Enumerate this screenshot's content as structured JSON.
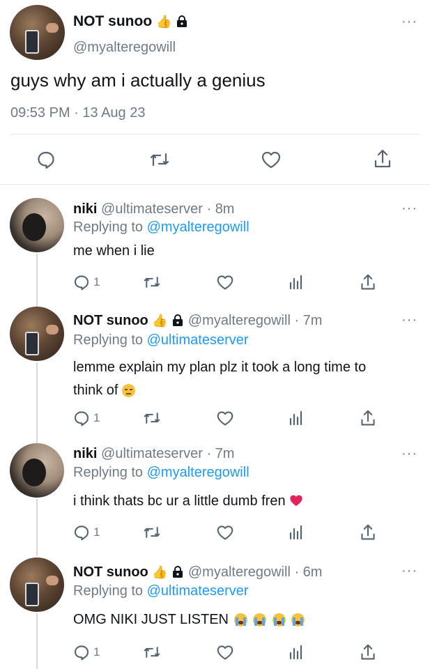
{
  "main_tweet": {
    "display_name": "NOT sunoo",
    "handle": "@myalteregowill",
    "text": "guys why am i actually a genius",
    "timestamp": "09:53 PM · 13 Aug 23"
  },
  "replies": [
    {
      "display_name": "niki",
      "meta": "@ultimateserver · 8m",
      "replying_label": "Replying to",
      "replying_to": "@myalteregowill",
      "text": "me when i lie",
      "reply_count": "1"
    },
    {
      "display_name": "NOT sunoo",
      "meta": "@myalteregowill · 7m",
      "replying_label": "Replying to",
      "replying_to": "@ultimateserver",
      "text_line1": "lemme explain my plan plz it took a long time to",
      "text_line2": "think of",
      "reply_count": "1"
    },
    {
      "display_name": "niki",
      "meta": "@ultimateserver · 7m",
      "replying_label": "Replying to",
      "replying_to": "@myalteregowill",
      "text": "i think thats bc ur a little dumb fren",
      "reply_count": "1"
    },
    {
      "display_name": "NOT sunoo",
      "meta": "@myalteregowill · 6m",
      "replying_label": "Replying to",
      "replying_to": "@ultimateserver",
      "text": "OMG NIKI JUST LISTEN",
      "reply_count": "1"
    }
  ],
  "colors": {
    "link": "#1d9bf0",
    "secondary": "#6e7b86",
    "text": "#0f1419",
    "heart_emoji": "#e0245e"
  },
  "icons": [
    "more-icon",
    "reply-icon",
    "retweet-icon",
    "like-icon",
    "share-icon",
    "views-icon",
    "lock-icon",
    "thumbs-up-emoji",
    "pensive-emoji",
    "red-heart-emoji",
    "loudly-crying-emoji"
  ]
}
